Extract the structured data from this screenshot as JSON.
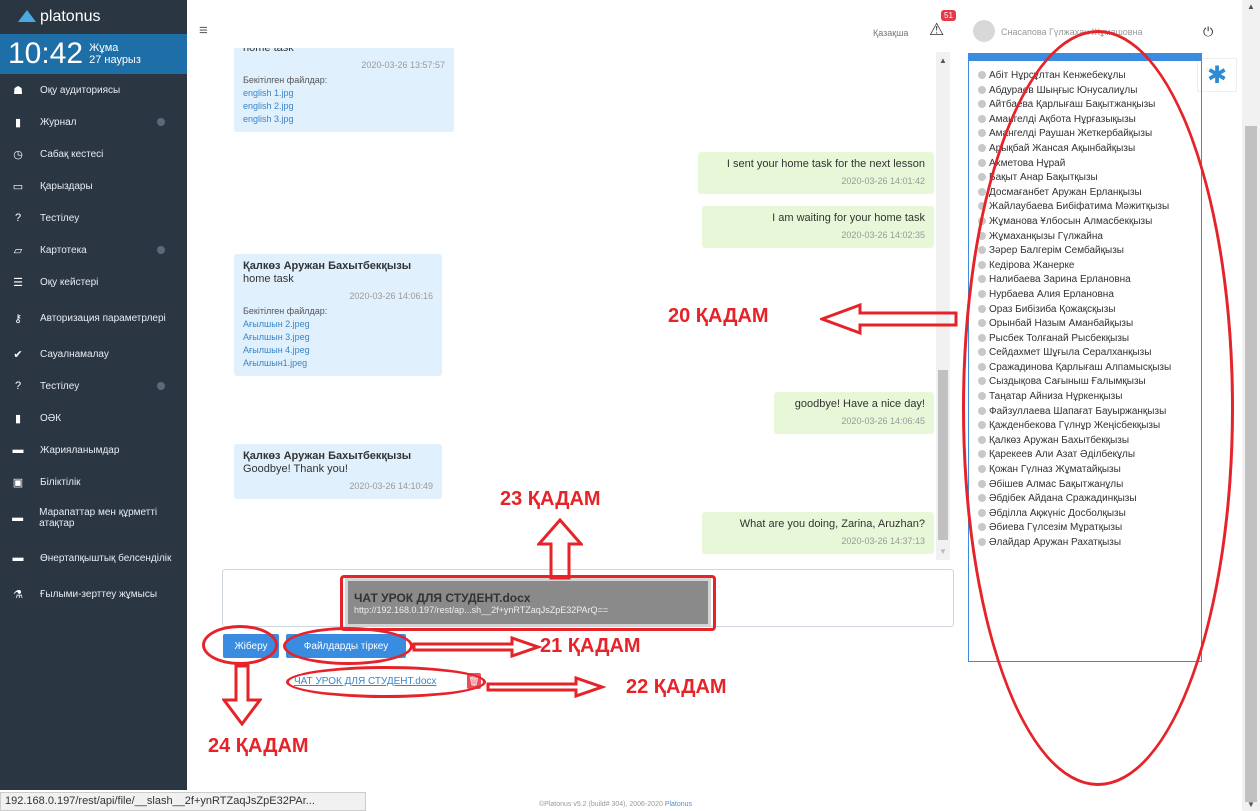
{
  "app": {
    "name": "platonus"
  },
  "clock": {
    "time": "10:42",
    "day": "Жұма",
    "date": "27 наурыз"
  },
  "sidebar": {
    "items": [
      {
        "label": "Оқу аудиториясы",
        "icon": "users-icon",
        "arrow": false
      },
      {
        "label": "Журнал",
        "icon": "book-icon",
        "arrow": true
      },
      {
        "label": "Сабақ кестесі",
        "icon": "clock-icon",
        "arrow": false
      },
      {
        "label": "Қарыздары",
        "icon": "card-icon",
        "arrow": false
      },
      {
        "label": "Тестілеу",
        "icon": "question-icon",
        "arrow": false
      },
      {
        "label": "Картотека",
        "icon": "folder-open-icon",
        "arrow": true
      },
      {
        "label": "Оқу кейстері",
        "icon": "list-icon",
        "arrow": false
      },
      {
        "label": "Авторизация параметрлері",
        "icon": "key-icon",
        "arrow": false
      },
      {
        "label": "Сауалнамалау",
        "icon": "check-circle-icon",
        "arrow": false
      },
      {
        "label": "Тестілеу",
        "icon": "question-icon",
        "arrow": true
      },
      {
        "label": "ОӘК",
        "icon": "book-icon",
        "arrow": false
      },
      {
        "label": "Жарияланымдар",
        "icon": "folder-icon",
        "arrow": false
      },
      {
        "label": "Біліктілік",
        "icon": "certificate-icon",
        "arrow": false
      },
      {
        "label": "Марапаттар мен құрметті атақтар",
        "icon": "folder-icon",
        "arrow": false
      },
      {
        "label": "Өнертапқыштық белсенділік",
        "icon": "folder-icon",
        "arrow": false
      },
      {
        "label": "Ғылыми-зерттеу жұмысы",
        "icon": "flask-icon",
        "arrow": false
      }
    ]
  },
  "header": {
    "language": "Қазақша",
    "notifications": "51",
    "user": "Снасапова Гүлжахан Жұмашовна"
  },
  "chat": {
    "messages": [
      {
        "dir": "in",
        "author": "",
        "text": "home task",
        "time": "2020-03-26 13:57:57",
        "files_label": "Бекітілген файлдар:",
        "files": [
          "english 1.jpg",
          "english 2.jpg",
          "english 3.jpg"
        ]
      },
      {
        "dir": "out",
        "text": "I sent your home task for the next lesson",
        "time": "2020-03-26 14:01:42"
      },
      {
        "dir": "out",
        "text": "I am waiting for your home task",
        "time": "2020-03-26 14:02:35"
      },
      {
        "dir": "in",
        "author": "Қалкөз Аружан Бахытбекқызы",
        "text": "home task",
        "time": "2020-03-26 14:06:16",
        "files_label": "Бекітілген файлдар:",
        "files": [
          "Ағылшын 2.jpeg",
          "Ағылшын 3.jpeg",
          "Ағылшын 4.jpeg",
          "Ағылшын1.jpeg"
        ]
      },
      {
        "dir": "out",
        "text": "goodbye! Have a nice day!",
        "time": "2020-03-26 14:06:45"
      },
      {
        "dir": "in",
        "author": "Қалкөз Аружан Бахытбекқызы",
        "text": "Goodbye! Thank you!",
        "time": "2020-03-26 14:10:49"
      },
      {
        "dir": "out",
        "text": "What are you doing, Zarina, Aruzhan?",
        "time": "2020-03-26 14:37:13"
      }
    ]
  },
  "composer": {
    "value": "",
    "tooltip_title": "ЧАТ УРОК ДЛЯ СТУДЕНТ.docx",
    "tooltip_url": "http://192.168.0.197/rest/ap...sh__2f+ynRTZaqJsZpE32PArQ==",
    "send_label": "Жіберу",
    "attach_label": "Файлдарды тіркеу",
    "attached_file": "ЧАТ УРОК ДЛЯ СТУДЕНТ.docx"
  },
  "students": [
    "Абіт Нұрсұлтан Кенжебекұлы",
    "Абдураев Шыңғыс Юнусалиұлы",
    "Айтбаева Қарлығаш Бақытжанқызы",
    "Амангелді Ақбота Нұрғазықызы",
    "Амангелді Раушан Жеткербайқызы",
    "Арықбай Жансая Ақынбайқызы",
    "Ахметова Нұрай",
    "Бақыт Анар Бақытқызы",
    "Досмағанбет Аружан Ерланқызы",
    "Жайлаубаева Бибіфатима Мәжитқызы",
    "Жұманова Ұлбосын Алмасбекқызы",
    "Жұмаханқызы Гүлжайна",
    "Зәрер Балгерім Сембайқызы",
    "Кедірова Жанерке",
    "Налибаева Зарина Ерлановна",
    "Нурбаева Алия Ерлановна",
    "Ораз Бибізиба Қожақсқызы",
    "Орынбай Назым Аманбайқызы",
    "Рысбек Толғанай Рысбекқызы",
    "Сейдахмет Шұғыла Сералханқызы",
    "Сражадинова Қарлығаш Алпамысқызы",
    "Сыздықова Сағыныш Ғалымқызы",
    "Таңатар Айниза Нұркенқызы",
    "Файзуллаева Шапағат Бауыржанқызы",
    "Қажденбекова Гүлнұр Жеңісбекқызы",
    "Қалкөз Аружан Бахытбекқызы",
    "Қарекеев Али Азат Әділбекұлы",
    "Қожан Гүлназ Жұматайқызы",
    "Әбішев Алмас Бақытжанұлы",
    "Әбдібек Айдана Сражадинқызы",
    "Әбділла Ақжүніс Досболқызы",
    "Әбиева Гүлсезім Мұратқызы",
    "Әлайдар Аружан Рахатқызы"
  ],
  "annotations": {
    "step20": "20 ҚАДАМ",
    "step21": "21 ҚАДАМ",
    "step22": "22 ҚАДАМ",
    "step23": "23 ҚАДАМ",
    "step24": "24 ҚАДАМ"
  },
  "status_bar": {
    "url": "192.168.0.197/rest/api/file/__slash__2f+ynRTZaqJsZpE32PAr..."
  },
  "footer": {
    "copyright": "©Platonus v5.2 (build# 304), 2006-2020",
    "link": "Platonus"
  },
  "colors": {
    "accent": "#3a8ce0",
    "sidebar": "#2b3643",
    "annotation": "#e52329",
    "incoming": "#e1f0fd",
    "outgoing": "#e7f7d8"
  }
}
